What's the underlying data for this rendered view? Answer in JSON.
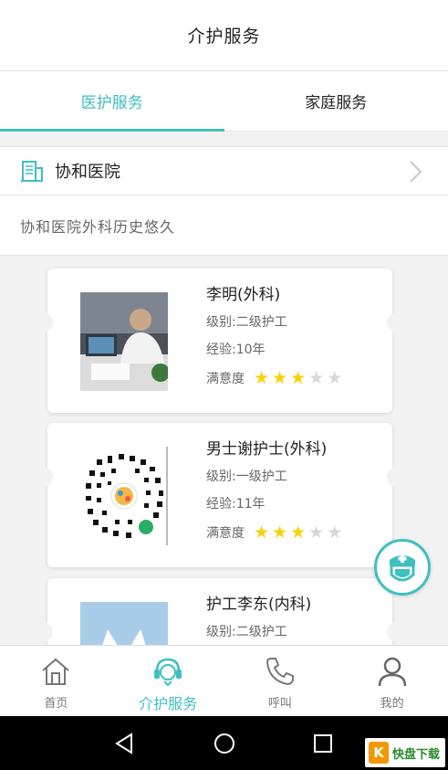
{
  "header": {
    "title": "介护服务"
  },
  "tabs": [
    {
      "label": "医护服务",
      "active": true
    },
    {
      "label": "家庭服务",
      "active": false
    }
  ],
  "hospital": {
    "name": "协和医院",
    "icon": "hospital-building-icon"
  },
  "description": "协和医院外科历史悠久",
  "caregivers": [
    {
      "name": "李明(外科)",
      "level": "级别:二级护工",
      "experience": "经验:10年",
      "satisfaction_label": "满意度",
      "rating": 3,
      "rating_max": 5
    },
    {
      "name": "男士谢护士(外科)",
      "level": "级别:一级护工",
      "experience": "经验:11年",
      "satisfaction_label": "满意度",
      "rating": 3,
      "rating_max": 5
    },
    {
      "name": "护工李东(内科)",
      "level": "级别:二级护工",
      "experience": "",
      "satisfaction_label": "",
      "rating": null,
      "rating_max": 5
    }
  ],
  "floating_button": {
    "icon": "nurse-icon"
  },
  "bottom_nav": [
    {
      "label": "首页",
      "icon": "home-icon",
      "active": false
    },
    {
      "label": "介护服务",
      "icon": "headset-icon",
      "active": true
    },
    {
      "label": "呼叫",
      "icon": "phone-icon",
      "active": false
    },
    {
      "label": "我的",
      "icon": "person-icon",
      "active": false
    }
  ],
  "watermark": {
    "letter": "K",
    "text": "快盘下载"
  },
  "colors": {
    "accent": "#3fbfbf",
    "star_on": "#f5d20a",
    "star_off": "#d7d7d7"
  }
}
